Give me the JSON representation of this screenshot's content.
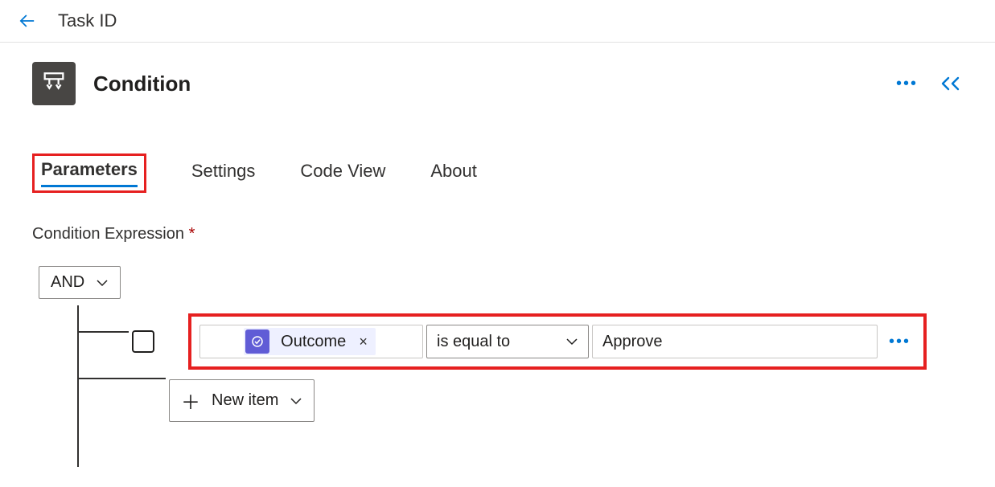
{
  "top": {
    "title": "Task ID"
  },
  "header": {
    "title": "Condition"
  },
  "tabs": {
    "parameters": "Parameters",
    "settings": "Settings",
    "codeview": "Code View",
    "about": "About"
  },
  "expression": {
    "label": "Condition Expression",
    "required": "*",
    "logic": "AND",
    "row": {
      "token": "Outcome",
      "token_remove": "×",
      "operator": "is equal to",
      "value": "Approve"
    },
    "new_item": "New item"
  },
  "icons": {
    "plus": "＋"
  }
}
